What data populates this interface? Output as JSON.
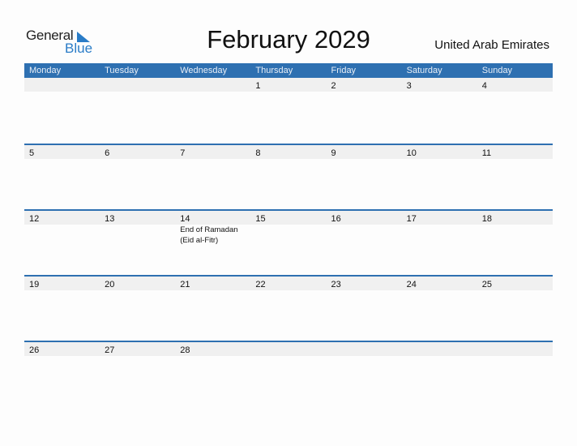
{
  "header": {
    "logo_general": "General",
    "logo_blue": "Blue",
    "title": "February 2029",
    "country": "United Arab Emirates"
  },
  "colors": {
    "accent": "#2e70b1",
    "date_strip": "#f0f0f0",
    "logo_blue": "#2a7cc7"
  },
  "weekdays": [
    "Monday",
    "Tuesday",
    "Wednesday",
    "Thursday",
    "Friday",
    "Saturday",
    "Sunday"
  ],
  "weeks": [
    {
      "days": [
        "",
        "",
        "",
        "1",
        "2",
        "3",
        "4"
      ],
      "events": [
        "",
        "",
        "",
        "",
        "",
        "",
        ""
      ]
    },
    {
      "days": [
        "5",
        "6",
        "7",
        "8",
        "9",
        "10",
        "11"
      ],
      "events": [
        "",
        "",
        "",
        "",
        "",
        "",
        ""
      ]
    },
    {
      "days": [
        "12",
        "13",
        "14",
        "15",
        "16",
        "17",
        "18"
      ],
      "events": [
        "",
        "",
        "End of Ramadan (Eid al-Fitr)",
        "",
        "",
        "",
        ""
      ]
    },
    {
      "days": [
        "19",
        "20",
        "21",
        "22",
        "23",
        "24",
        "25"
      ],
      "events": [
        "",
        "",
        "",
        "",
        "",
        "",
        ""
      ]
    },
    {
      "days": [
        "26",
        "27",
        "28",
        "",
        "",
        "",
        ""
      ],
      "events": [
        "",
        "",
        "",
        "",
        "",
        "",
        ""
      ]
    }
  ]
}
